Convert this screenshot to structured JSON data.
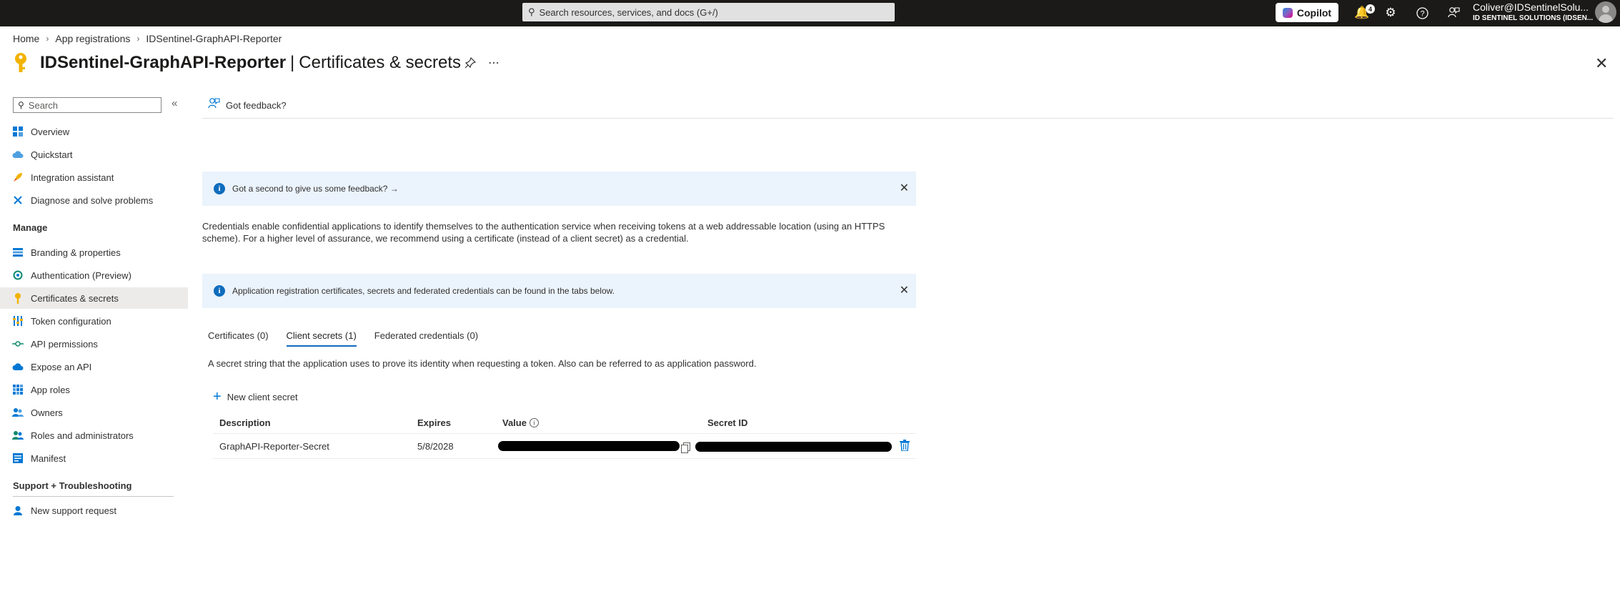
{
  "topbar": {
    "search_placeholder": "Search resources, services, and docs (G+/)",
    "copilot_label": "Copilot",
    "notification_count": "4",
    "user_name": "Coliver@IDSentinelSolu...",
    "user_org": "ID SENTINEL SOLUTIONS (IDSEN..."
  },
  "breadcrumb": [
    "Home",
    "App registrations",
    "IDSentinel-GraphAPI-Reporter"
  ],
  "page": {
    "app_name": "IDSentinel-GraphAPI-Reporter",
    "section": "Certificates & secrets"
  },
  "sidebar": {
    "search_placeholder": "Search",
    "top_items": [
      {
        "label": "Overview"
      },
      {
        "label": "Quickstart"
      },
      {
        "label": "Integration assistant"
      },
      {
        "label": "Diagnose and solve problems"
      }
    ],
    "manage_heading": "Manage",
    "manage_items": [
      {
        "label": "Branding & properties"
      },
      {
        "label": "Authentication (Preview)"
      },
      {
        "label": "Certificates & secrets"
      },
      {
        "label": "Token configuration"
      },
      {
        "label": "API permissions"
      },
      {
        "label": "Expose an API"
      },
      {
        "label": "App roles"
      },
      {
        "label": "Owners"
      },
      {
        "label": "Roles and administrators"
      },
      {
        "label": "Manifest"
      }
    ],
    "support_heading": "Support + Troubleshooting",
    "support_items": [
      {
        "label": "New support request"
      }
    ]
  },
  "commandbar": {
    "feedback": "Got feedback?"
  },
  "banners": {
    "feedback": "Got a second to give us some feedback? →",
    "tabs_info": "Application registration certificates, secrets and federated credentials can be found in the tabs below."
  },
  "description": "Credentials enable confidential applications to identify themselves to the authentication service when receiving tokens at a web addressable location (using an HTTPS scheme). For a higher level of assurance, we recommend using a certificate (instead of a client secret) as a credential.",
  "tabs": [
    {
      "label": "Certificates (0)",
      "active": false
    },
    {
      "label": "Client secrets (1)",
      "active": true
    },
    {
      "label": "Federated credentials (0)",
      "active": false
    }
  ],
  "tab_description": "A secret string that the application uses to prove its identity when requesting a token. Also can be referred to as application password.",
  "new_secret_label": "New client secret",
  "table": {
    "headers": {
      "description": "Description",
      "expires": "Expires",
      "value": "Value",
      "secret_id": "Secret ID"
    },
    "rows": [
      {
        "description": "GraphAPI-Reporter-Secret",
        "expires": "5/8/2028"
      }
    ]
  },
  "colors": {
    "accent": "#0078d4",
    "topbar": "#1b1a19",
    "info_banner": "#ebf3fc",
    "active_nav": "#edebe9"
  }
}
